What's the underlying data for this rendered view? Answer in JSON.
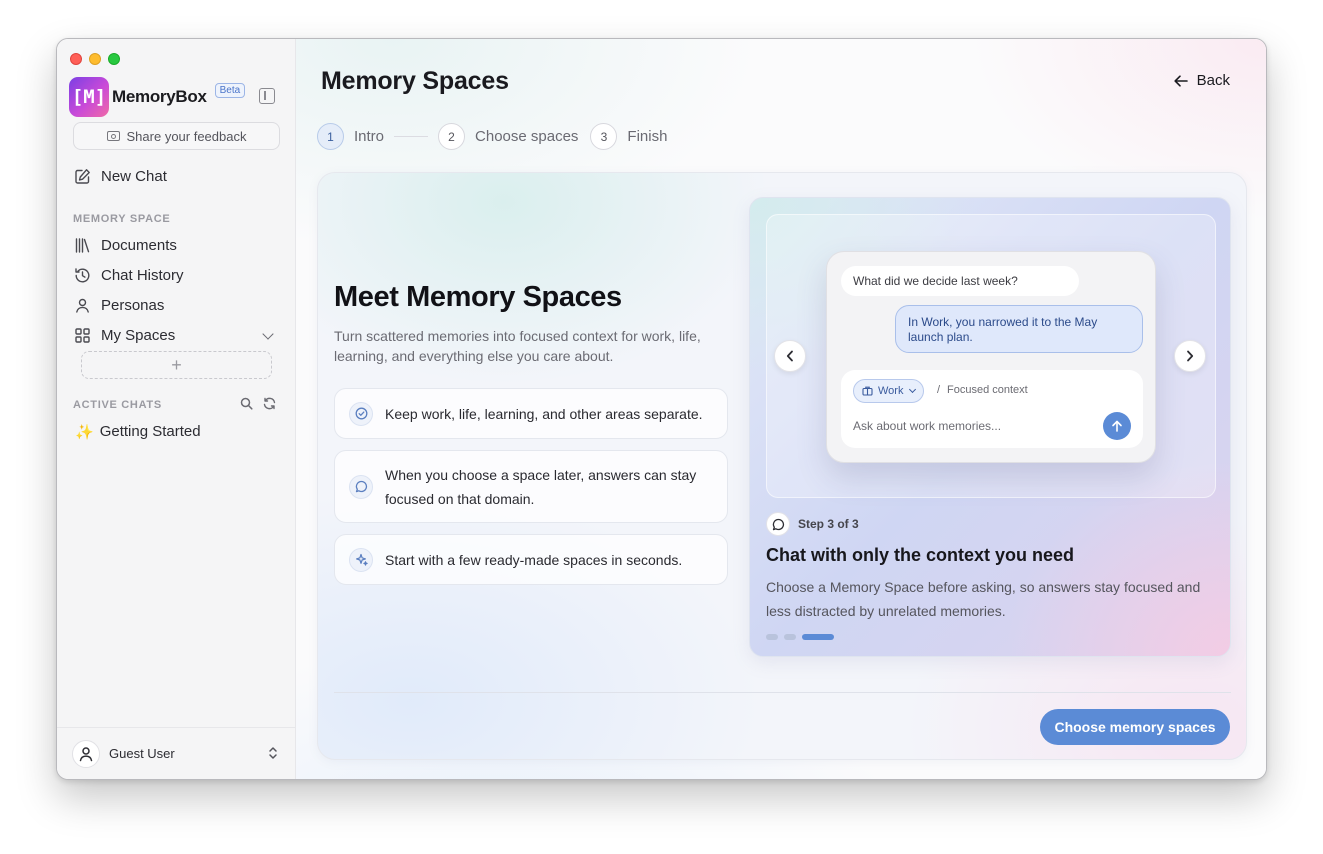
{
  "app": {
    "name": "MemoryBox",
    "logo_text": "[M]",
    "beta_label": "Beta",
    "accent_color": "#5b8bd6"
  },
  "sidebar": {
    "feedback_label": "Share your feedback",
    "new_chat_label": "New Chat",
    "memory_section_label": "MEMORY SPACE",
    "items": [
      {
        "label": "Documents",
        "icon": "library-icon"
      },
      {
        "label": "Chat History",
        "icon": "history-icon"
      },
      {
        "label": "Personas",
        "icon": "person-icon"
      },
      {
        "label": "My Spaces",
        "icon": "grid-icon"
      }
    ],
    "add_space_symbol": "+",
    "active_chats_label": "ACTIVE CHATS",
    "chats": [
      {
        "emoji": "✨",
        "label": "Getting Started"
      }
    ],
    "user": {
      "name": "Guest User"
    }
  },
  "header": {
    "title": "Memory Spaces",
    "back_label": "Back"
  },
  "stepper": [
    {
      "num": "1",
      "label": "Intro",
      "active": true
    },
    {
      "num": "2",
      "label": "Choose spaces",
      "active": false
    },
    {
      "num": "3",
      "label": "Finish",
      "active": false
    }
  ],
  "intro": {
    "title": "Meet Memory Spaces",
    "subtitle": "Turn scattered memories into focused context for work, life, learning, and everything else you care about.",
    "features": [
      {
        "icon": "check-circle-icon",
        "text": "Keep work, life, learning, and other areas separate."
      },
      {
        "icon": "chat-bubble-icon",
        "text": "When you choose a space later, answers can stay focused on that domain."
      },
      {
        "icon": "sparkle-icon",
        "text": "Start with a few ready-made spaces in seconds."
      }
    ]
  },
  "carousel": {
    "mock": {
      "question": "What did we decide last week?",
      "answer": "In Work, you narrowed it to the May launch plan.",
      "chip_label": "Work",
      "separator": "/",
      "context_label": "Focused context",
      "input_placeholder": "Ask about work memories..."
    },
    "step_label": "Step 3 of 3",
    "title": "Chat with only the context you need",
    "description": "Choose a Memory Space before asking, so answers stay focused and less distracted by unrelated memories.",
    "total_slides": 3,
    "active_slide": 3
  },
  "cta_label": "Choose memory spaces"
}
